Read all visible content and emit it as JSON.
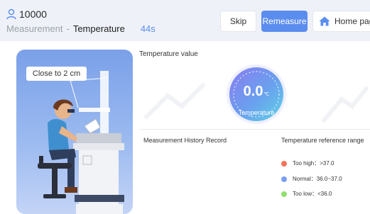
{
  "header": {
    "user_icon": "user-icon",
    "user_id": "10000",
    "breadcrumb": {
      "parent": "Measurement",
      "separator": "-",
      "current": "Temperature"
    },
    "timer": "44s"
  },
  "toolbar": {
    "skip_label": "Skip",
    "remeasure_label": "Remeasure",
    "home_label": "Home page",
    "home_icon": "home-icon"
  },
  "illustration": {
    "tip": "Close to 2 cm"
  },
  "measurement": {
    "section_title": "Temperature value",
    "value": "0.0",
    "unit": "℃",
    "gauge_label": "Temperature"
  },
  "history": {
    "title": "Measurement History Record"
  },
  "reference": {
    "title": "Temperature reference range",
    "items": [
      {
        "label": "Too high：>37.0",
        "color": "#f2735a"
      },
      {
        "label": "Normal：36.0~37.0",
        "color": "#7d9ff2"
      },
      {
        "label": "Too low：<36.0",
        "color": "#8fe06c"
      }
    ]
  },
  "colors": {
    "accent": "#5b8def",
    "header_bg": "#eef1f8"
  }
}
